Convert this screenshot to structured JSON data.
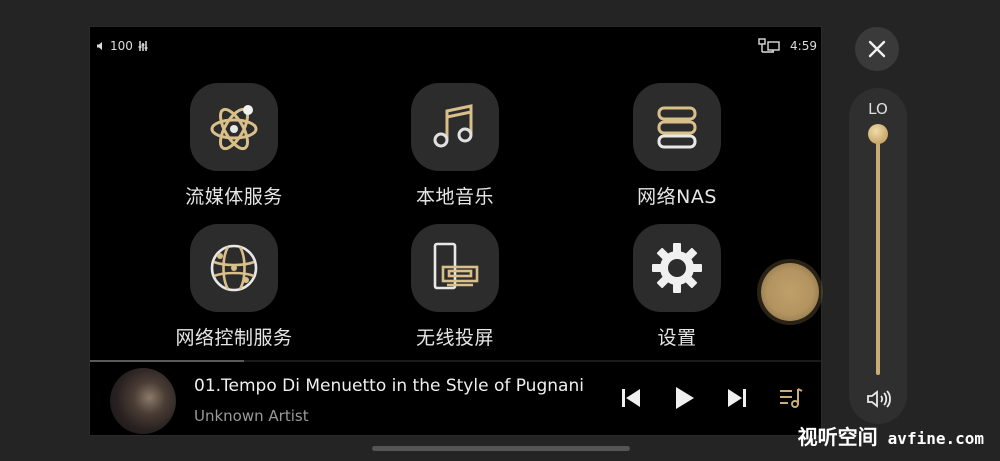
{
  "status": {
    "volume": "100",
    "time": "4:59"
  },
  "tiles": [
    {
      "label": "流媒体服务",
      "icon": "atom-icon"
    },
    {
      "label": "本地音乐",
      "icon": "music-note-icon"
    },
    {
      "label": "网络NAS",
      "icon": "server-stack-icon"
    },
    {
      "label": "网络控制服务",
      "icon": "globe-network-icon"
    },
    {
      "label": "无线投屏",
      "icon": "cast-device-icon"
    },
    {
      "label": "设置",
      "icon": "gear-icon"
    }
  ],
  "now_playing": {
    "title": "01.Tempo Di Menuetto in the Style of Pugnani",
    "artist": "Unknown Artist",
    "progress": 0.21
  },
  "volume_panel": {
    "label": "LO",
    "level": 0.0
  },
  "watermark": {
    "cn": "视听空间",
    "en": "avfine.com"
  },
  "colors": {
    "accent": "#d9c08a",
    "tile_bg": "#2c2c2c",
    "screen_bg": "#000000"
  }
}
